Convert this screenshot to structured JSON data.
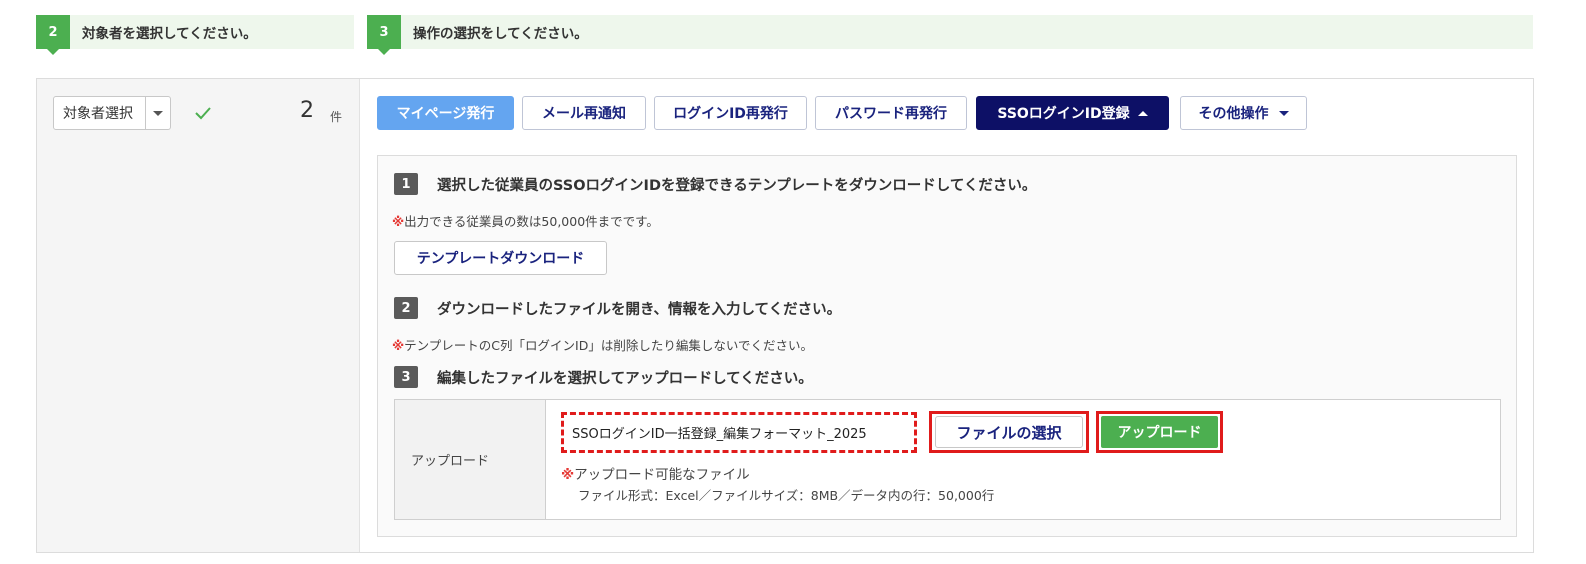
{
  "steps": {
    "target": {
      "num": "2",
      "title": "対象者を選択してください。"
    },
    "operation": {
      "num": "3",
      "title": "操作の選択をしてください。"
    }
  },
  "target_select": {
    "label": "対象者選択",
    "count": "2",
    "unit": "件"
  },
  "operations": {
    "mypage": "マイページ発行",
    "mail": "メール再通知",
    "loginid": "ログインID再発行",
    "password": "パスワード再発行",
    "sso": "SSOログインID登録",
    "other": "その他操作"
  },
  "sso_panel": {
    "step1": {
      "num": "1",
      "text": "選択した従業員のSSOログインIDを登録できるテンプレートをダウンロードしてください。"
    },
    "note1": {
      "mark": "※",
      "text": "出力できる従業員の数は50,000件までです。"
    },
    "template_button": "テンプレートダウンロード",
    "step2": {
      "num": "2",
      "text": "ダウンロードしたファイルを開き、情報を入力してください。"
    },
    "note2": {
      "mark": "※",
      "text": "テンプレートのC列「ログインID」は削除したり編集しないでください。"
    },
    "step3": {
      "num": "3",
      "text": "編集したファイルを選択してアップロードしてください。"
    },
    "upload": {
      "label": "アップロード",
      "file_value": "SSOログインID一括登録_編集フォーマット_2025",
      "choose_button": "ファイルの選択",
      "upload_button": "アップロード",
      "note_mark": "※",
      "note_title": "アップロード可能なファイル",
      "note_detail": "ファイル形式：Excel／ファイルサイズ：8MB／データ内の行：50,000行"
    }
  },
  "colors": {
    "accent_green": "#4caf50",
    "navy": "#0d1066",
    "light_blue": "#64a5f0",
    "highlight_red": "#e01b1b"
  }
}
